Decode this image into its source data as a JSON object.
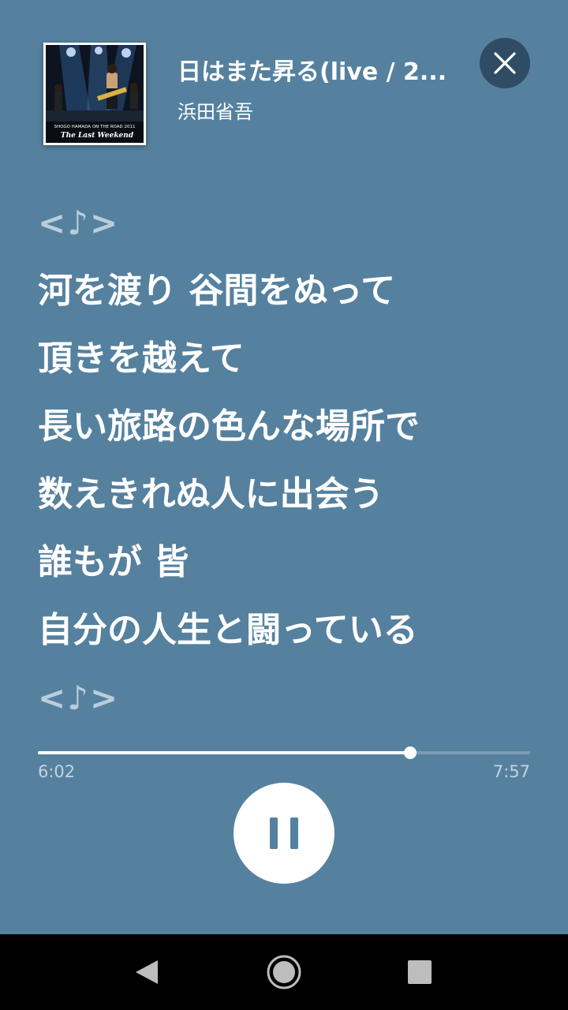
{
  "now_playing": {
    "title": "日はまた昇る(live / 2...",
    "artist": "浜田省吾",
    "album_art_text": {
      "top_line": "SHOGO HAMADA ON THE ROAD 2011",
      "title": "The Last Weekend"
    }
  },
  "icons": {
    "close": "close-icon",
    "pause": "pause-icon",
    "back": "back-triangle-icon",
    "home": "home-circle-icon",
    "recents": "recents-square-icon"
  },
  "lyrics": {
    "marker_top": "<♪>",
    "lines": [
      "河を渡り 谷間をぬって",
      "頂きを越えて",
      "長い旅路の色んな場所で",
      "数えきれぬ人に出会う",
      "誰もが 皆",
      "自分の人生と闘っている"
    ],
    "marker_bottom": "<♪>"
  },
  "playback": {
    "elapsed": "6:02",
    "total": "7:57",
    "progress_fraction": 0.757
  },
  "colors": {
    "background": "#55819f",
    "close_button": "#2f4c64",
    "marker_text": "#b9cddb"
  }
}
